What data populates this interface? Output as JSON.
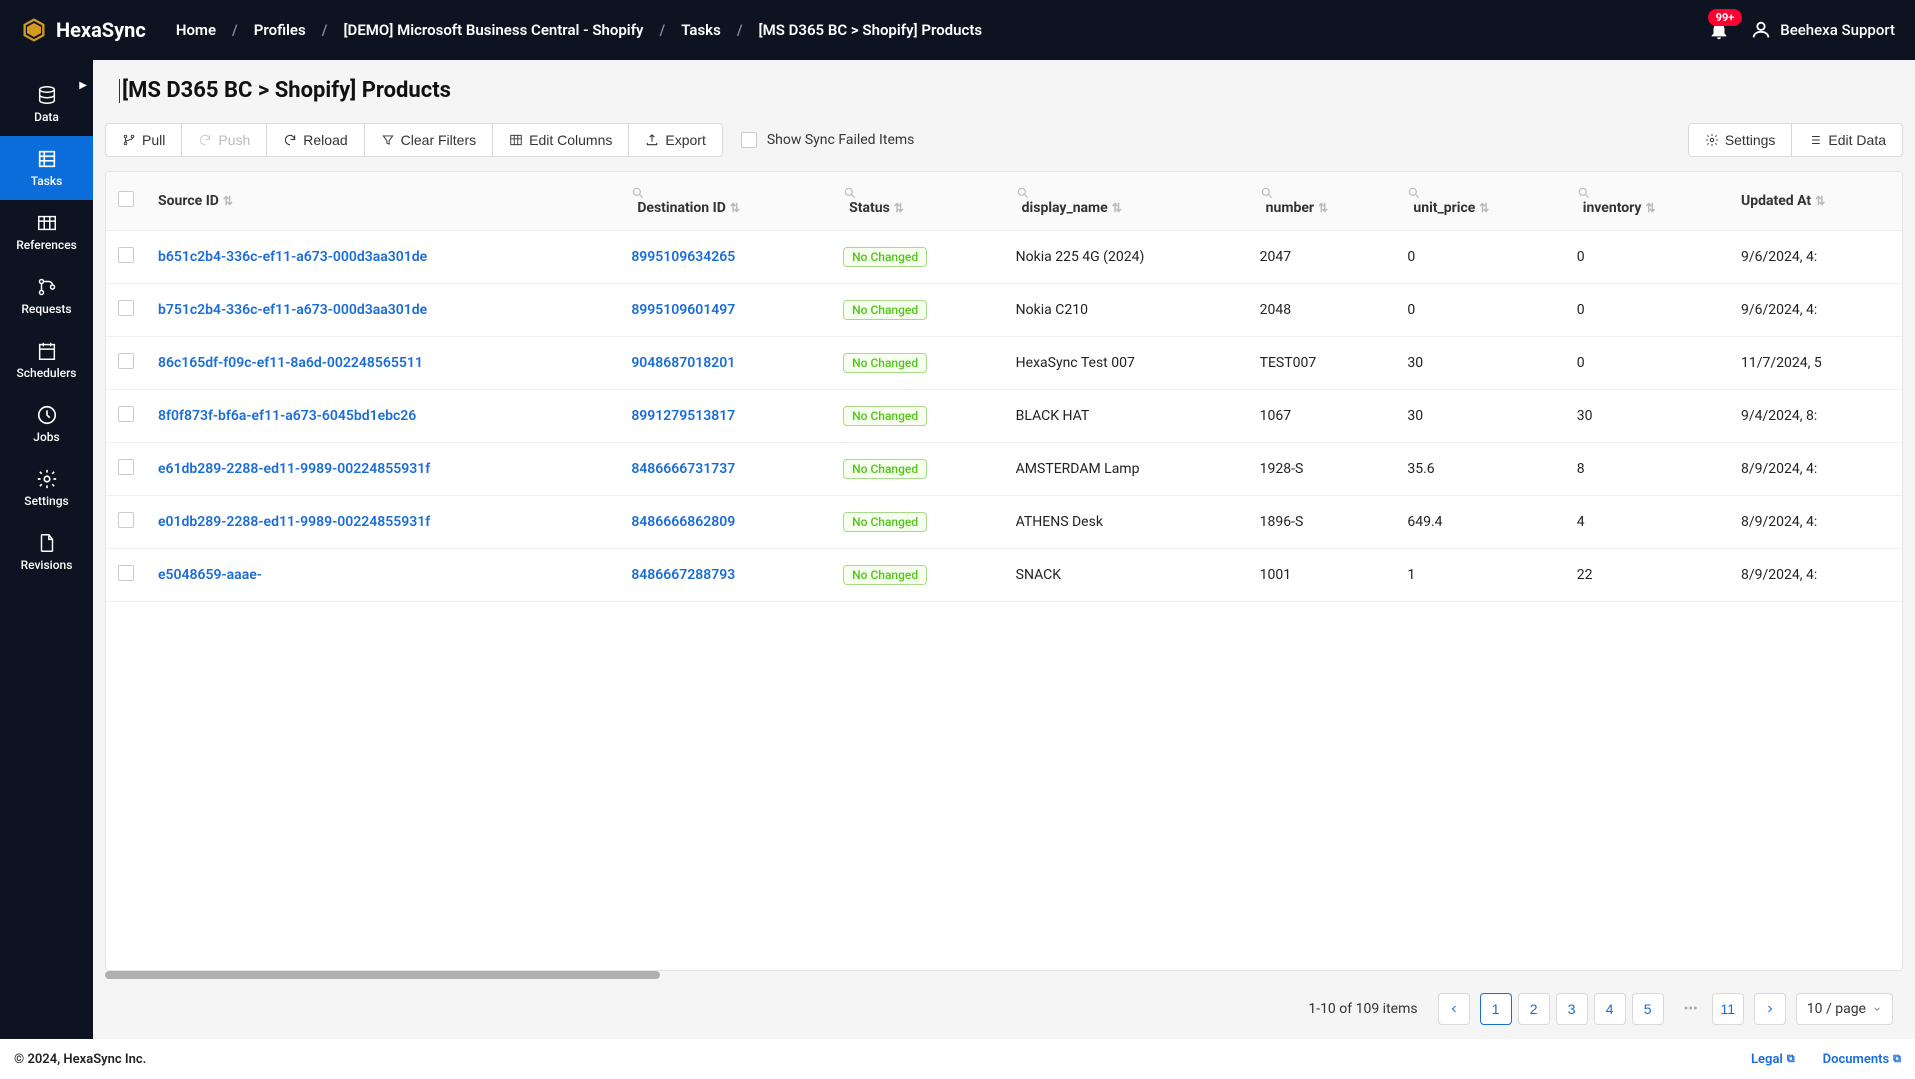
{
  "brand": {
    "name": "HexaSync",
    "accent": "#d49a1d"
  },
  "breadcrumbs": [
    "Home",
    "Profiles",
    "[DEMO] Microsoft Business Central - Shopify",
    "Tasks",
    "[MS D365 BC > Shopify] Products"
  ],
  "notification_badge": "99+",
  "user_name": "Beehexa Support",
  "sidebar": {
    "items": [
      {
        "label": "Data"
      },
      {
        "label": "Tasks"
      },
      {
        "label": "References"
      },
      {
        "label": "Requests"
      },
      {
        "label": "Schedulers"
      },
      {
        "label": "Jobs"
      },
      {
        "label": "Settings"
      },
      {
        "label": "Revisions"
      }
    ],
    "active_index": 1
  },
  "page_title": "[MS D365 BC > Shopify] Products",
  "toolbar": {
    "pull": "Pull",
    "push": "Push",
    "reload": "Reload",
    "clear_filters": "Clear Filters",
    "edit_columns": "Edit Columns",
    "export": "Export",
    "show_failed": "Show Sync Failed Items",
    "settings": "Settings",
    "edit_data": "Edit Data"
  },
  "columns": [
    "Source ID",
    "Destination ID",
    "Status",
    "display_name",
    "number",
    "unit_price",
    "inventory",
    "Updated At"
  ],
  "rows": [
    {
      "source_id": "b651c2b4-336c-ef11-a673-000d3aa301de",
      "dest_id": "8995109634265",
      "status": "No Changed",
      "display_name": "Nokia 225 4G (2024)",
      "number": "2047",
      "unit_price": "0",
      "inventory": "0",
      "updated": "9/6/2024, 4:"
    },
    {
      "source_id": "b751c2b4-336c-ef11-a673-000d3aa301de",
      "dest_id": "8995109601497",
      "status": "No Changed",
      "display_name": "Nokia C210",
      "number": "2048",
      "unit_price": "0",
      "inventory": "0",
      "updated": "9/6/2024, 4:"
    },
    {
      "source_id": "86c165df-f09c-ef11-8a6d-002248565511",
      "dest_id": "9048687018201",
      "status": "No Changed",
      "display_name": "HexaSync Test 007",
      "number": "TEST007",
      "unit_price": "30",
      "inventory": "0",
      "updated": "11/7/2024, 5"
    },
    {
      "source_id": "8f0f873f-bf6a-ef11-a673-6045bd1ebc26",
      "dest_id": "8991279513817",
      "status": "No Changed",
      "display_name": "BLACK HAT",
      "number": "1067",
      "unit_price": "30",
      "inventory": "30",
      "updated": "9/4/2024, 8:"
    },
    {
      "source_id": "e61db289-2288-ed11-9989-00224855931f",
      "dest_id": "8486666731737",
      "status": "No Changed",
      "display_name": "AMSTERDAM Lamp",
      "number": "1928-S",
      "unit_price": "35.6",
      "inventory": "8",
      "updated": "8/9/2024, 4:"
    },
    {
      "source_id": "e01db289-2288-ed11-9989-00224855931f",
      "dest_id": "8486666862809",
      "status": "No Changed",
      "display_name": "ATHENS Desk",
      "number": "1896-S",
      "unit_price": "649.4",
      "inventory": "4",
      "updated": "8/9/2024, 4:"
    },
    {
      "source_id": "e5048659-aaae-",
      "dest_id": "8486667288793",
      "status": "No Changed",
      "display_name": "SNACK",
      "number": "1001",
      "unit_price": "1",
      "inventory": "22",
      "updated": "8/9/2024, 4:"
    }
  ],
  "pagination": {
    "info": "1-10 of 109 items",
    "pages": [
      "1",
      "2",
      "3",
      "4",
      "5"
    ],
    "last_page": "11",
    "active_page": "1",
    "size_label": "10 / page"
  },
  "footer": {
    "copyright": "© 2024, HexaSync Inc.",
    "legal": "Legal",
    "documents": "Documents"
  }
}
